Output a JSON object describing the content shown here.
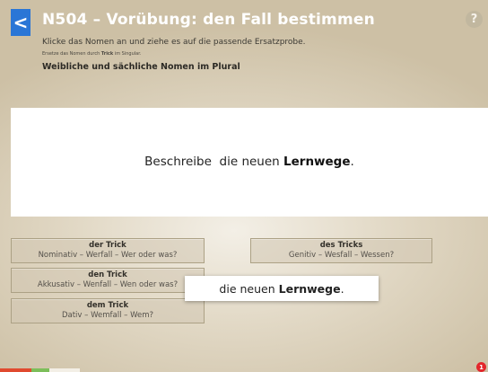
{
  "header": {
    "back_label": "<",
    "title": "N504 – Vorübung: den Fall bestimmen",
    "help_label": "?"
  },
  "instructions": {
    "line1": "Klicke das Nomen an und ziehe es auf die passende Ersatzprobe.",
    "line2_prefix": "Ersetze das Nomen durch ",
    "line2_bold": "Trick",
    "line2_suffix": " im Singular.",
    "subtitle": "Weibliche und sächliche Nomen im Plural"
  },
  "sentence": {
    "verb": "Beschreibe",
    "article": "die neuen",
    "noun": "Lernwege",
    "end": "."
  },
  "options": [
    {
      "title": "der Trick",
      "detail": "Nominativ – Werfall – Wer oder was?"
    },
    {
      "title": "den Trick",
      "detail": "Akkusativ – Wenfall – Wen oder was?"
    },
    {
      "title": "dem Trick",
      "detail": "Dativ – Wemfall – Wem?"
    },
    {
      "title": "des Tricks",
      "detail": "Genitiv – Wesfall – Wessen?"
    }
  ],
  "drag_card": {
    "article": "die neuen",
    "noun": "Lernwege",
    "end": "."
  },
  "progress": {
    "correct": 1,
    "wrong": 1
  },
  "badge": {
    "count": "1"
  },
  "colors": {
    "accent_blue": "#2a76d6",
    "progress_red": "#e04a2f",
    "progress_green": "#7cbe5a",
    "badge_red": "#e3262b"
  }
}
